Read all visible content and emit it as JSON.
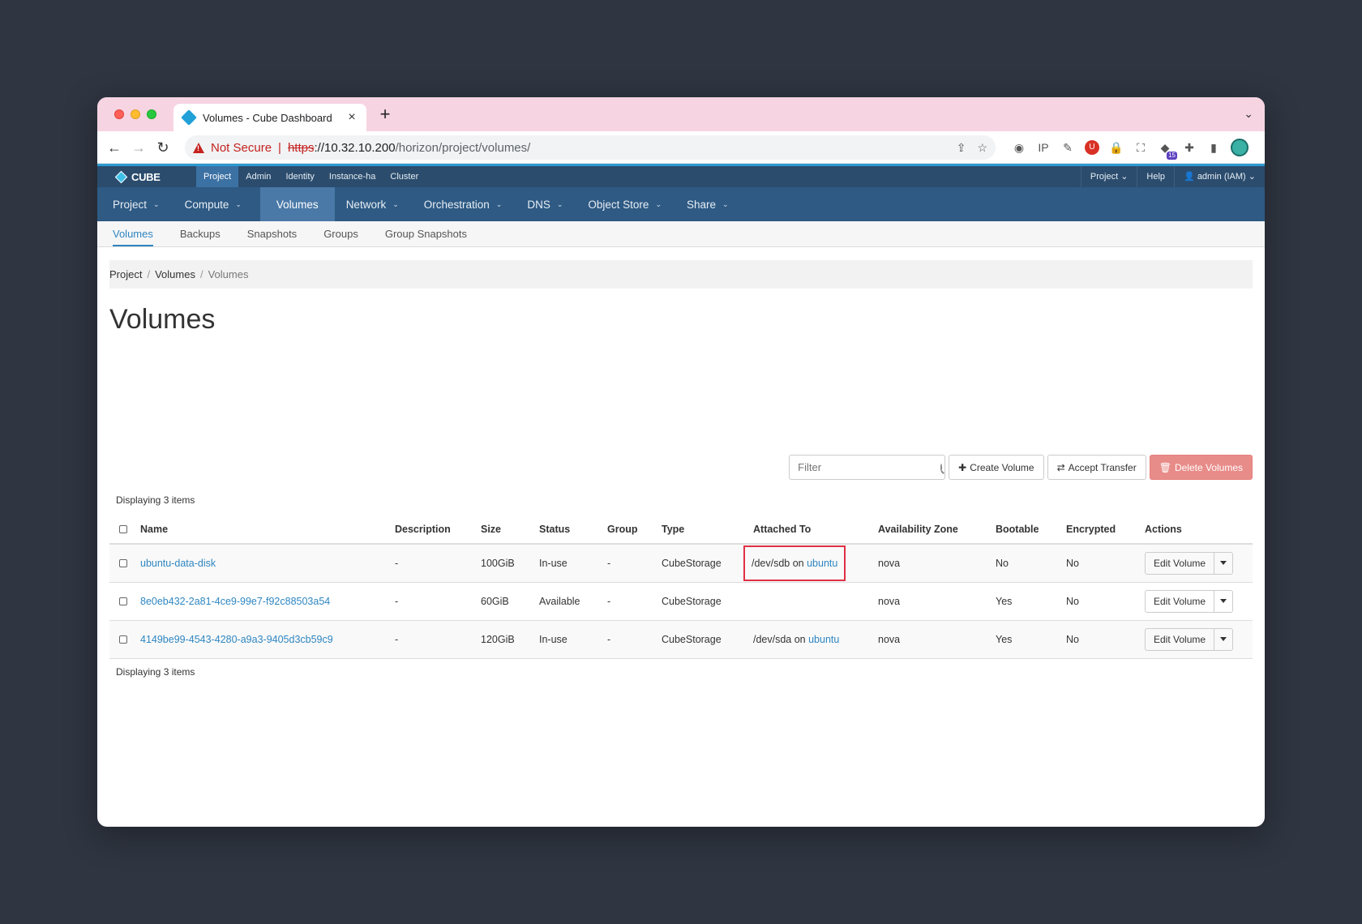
{
  "browser": {
    "tab_title": "Volumes - Cube Dashboard",
    "security_label": "Not Secure",
    "url_scheme": "https",
    "url_host": "://10.32.10.200",
    "url_path": "/horizon/project/volumes/",
    "extension_badge": "15"
  },
  "header": {
    "brand": "CUBE",
    "top_tabs": [
      "Project",
      "Admin",
      "Identity",
      "Instance-ha",
      "Cluster"
    ],
    "right_project": "Project",
    "right_help": "Help",
    "right_user": "admin (IAM)"
  },
  "main_nav": [
    "Project",
    "Compute",
    "Volumes",
    "Network",
    "Orchestration",
    "DNS",
    "Object Store",
    "Share"
  ],
  "subnav": [
    "Volumes",
    "Backups",
    "Snapshots",
    "Groups",
    "Group Snapshots"
  ],
  "breadcrumb": [
    "Project",
    "Volumes",
    "Volumes"
  ],
  "page_title": "Volumes",
  "filter_placeholder": "Filter",
  "buttons": {
    "create": "Create Volume",
    "accept": "Accept Transfer",
    "delete": "Delete Volumes"
  },
  "display_count": "Displaying 3 items",
  "columns": [
    "Name",
    "Description",
    "Size",
    "Status",
    "Group",
    "Type",
    "Attached To",
    "Availability Zone",
    "Bootable",
    "Encrypted",
    "Actions"
  ],
  "rows": [
    {
      "name": "ubuntu-data-disk",
      "description": "-",
      "size": "100GiB",
      "status": "In-use",
      "group": "-",
      "type": "CubeStorage",
      "attached_dev": "/dev/sdb on ",
      "attached_host": "ubuntu",
      "zone": "nova",
      "bootable": "No",
      "encrypted": "No",
      "action": "Edit Volume"
    },
    {
      "name": "8e0eb432-2a81-4ce9-99e7-f92c88503a54",
      "description": "-",
      "size": "60GiB",
      "status": "Available",
      "group": "-",
      "type": "CubeStorage",
      "attached_dev": "",
      "attached_host": "",
      "zone": "nova",
      "bootable": "Yes",
      "encrypted": "No",
      "action": "Edit Volume"
    },
    {
      "name": "4149be99-4543-4280-a9a3-9405d3cb59c9",
      "description": "-",
      "size": "120GiB",
      "status": "In-use",
      "group": "-",
      "type": "CubeStorage",
      "attached_dev": "/dev/sda on ",
      "attached_host": "ubuntu",
      "zone": "nova",
      "bootable": "Yes",
      "encrypted": "No",
      "action": "Edit Volume"
    }
  ],
  "colors": {
    "accent": "#2e86c1",
    "header_top": "#2b4c6d",
    "header_main": "#2e5a84",
    "danger": "#e88c89",
    "highlight_box": "#e03044"
  }
}
